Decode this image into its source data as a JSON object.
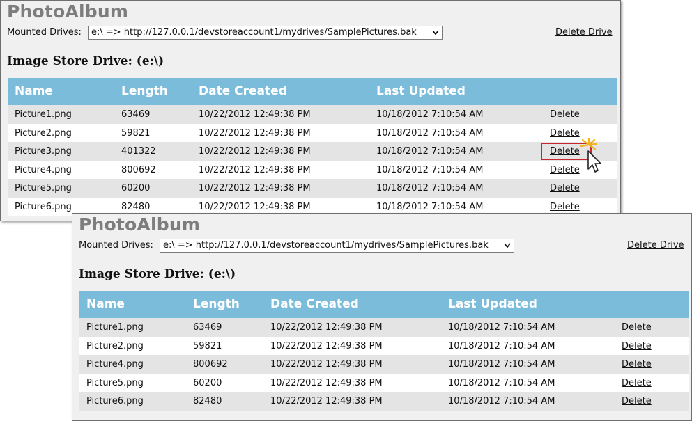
{
  "panels": [
    {
      "app_title": "PhotoAlbum",
      "mounted_drives_label": "Mounted Drives:",
      "mounted_drive_selected": "e:\\ => http://127.0.0.1/devstoreaccount1/mydrives/SamplePictures.bak",
      "delete_drive_label": "Delete Drive",
      "store_heading": "Image Store Drive: (e:\\)",
      "columns": [
        "Name",
        "Length",
        "Date Created",
        "Last Updated"
      ],
      "rows": [
        {
          "name": "Picture1.png",
          "length": "63469",
          "created": "10/22/2012 12:49:38 PM",
          "updated": "10/18/2012 7:10:54 AM",
          "action": "Delete"
        },
        {
          "name": "Picture2.png",
          "length": "59821",
          "created": "10/22/2012 12:49:38 PM",
          "updated": "10/18/2012 7:10:54 AM",
          "action": "Delete"
        },
        {
          "name": "Picture3.png",
          "length": "401322",
          "created": "10/22/2012 12:49:38 PM",
          "updated": "10/18/2012 7:10:54 AM",
          "action": "Delete"
        },
        {
          "name": "Picture4.png",
          "length": "800692",
          "created": "10/22/2012 12:49:38 PM",
          "updated": "10/18/2012 7:10:54 AM",
          "action": "Delete"
        },
        {
          "name": "Picture5.png",
          "length": "60200",
          "created": "10/22/2012 12:49:38 PM",
          "updated": "10/18/2012 7:10:54 AM",
          "action": "Delete"
        },
        {
          "name": "Picture6.png",
          "length": "82480",
          "created": "10/22/2012 12:49:38 PM",
          "updated": "10/18/2012 7:10:54 AM",
          "action": "Delete"
        }
      ]
    },
    {
      "app_title": "PhotoAlbum",
      "mounted_drives_label": "Mounted Drives:",
      "mounted_drive_selected": "e:\\ => http://127.0.0.1/devstoreaccount1/mydrives/SamplePictures.bak",
      "delete_drive_label": "Delete Drive",
      "store_heading": "Image Store Drive: (e:\\)",
      "columns": [
        "Name",
        "Length",
        "Date Created",
        "Last Updated"
      ],
      "rows": [
        {
          "name": "Picture1.png",
          "length": "63469",
          "created": "10/22/2012 12:49:38 PM",
          "updated": "10/18/2012 7:10:54 AM",
          "action": "Delete"
        },
        {
          "name": "Picture2.png",
          "length": "59821",
          "created": "10/22/2012 12:49:38 PM",
          "updated": "10/18/2012 7:10:54 AM",
          "action": "Delete"
        },
        {
          "name": "Picture4.png",
          "length": "800692",
          "created": "10/22/2012 12:49:38 PM",
          "updated": "10/18/2012 7:10:54 AM",
          "action": "Delete"
        },
        {
          "name": "Picture5.png",
          "length": "60200",
          "created": "10/22/2012 12:49:38 PM",
          "updated": "10/18/2012 7:10:54 AM",
          "action": "Delete"
        },
        {
          "name": "Picture6.png",
          "length": "82480",
          "created": "10/22/2012 12:49:38 PM",
          "updated": "10/18/2012 7:10:54 AM",
          "action": "Delete"
        }
      ]
    }
  ],
  "annotation": {
    "highlight_color": "#c8262f",
    "cursor_icon": "pointer-cursor-click-icon"
  },
  "colors": {
    "header_bg": "#7cbcdb",
    "panel_bg": "#f0f0f0",
    "row_alt_bg": "#e4e4e4",
    "title_gray": "#7d7d7d"
  }
}
